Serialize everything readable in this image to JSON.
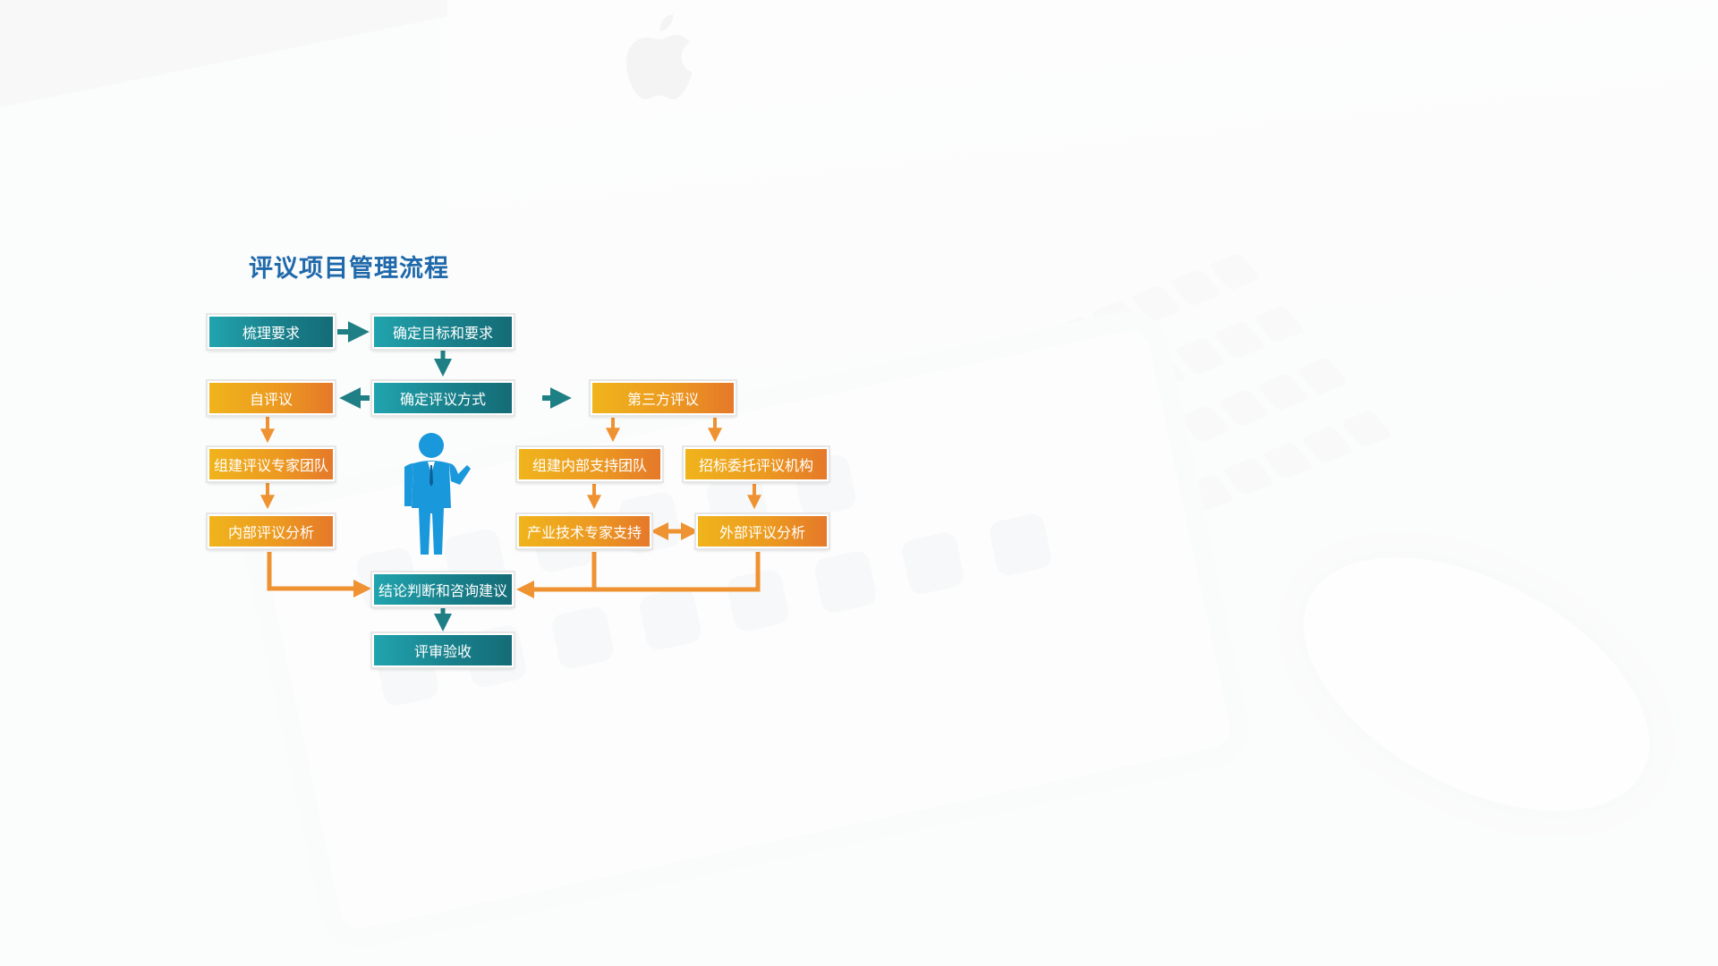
{
  "title": "评议项目管理流程",
  "colors": {
    "title": "#1f69ab",
    "teal": "#1a8792",
    "orange": "#ee9a20",
    "teal_arrow": "#1e7f85",
    "orange_arrow": "#ef9231",
    "person": "#1a98dc"
  },
  "nodes": {
    "sort_requirements": "梳理要求",
    "define_goals": "确定目标和要求",
    "define_method": "确定评议方式",
    "self_review": "自评议",
    "third_party": "第三方评议",
    "build_expert_team": "组建评议专家团队",
    "internal_analysis": "内部评议分析",
    "build_support_team": "组建内部支持团队",
    "tender_agency": "招标委托评议机构",
    "industry_expert_support": "产业技术专家支持",
    "external_analysis": "外部评议分析",
    "conclusion": "结论判断和咨询建议",
    "acceptance": "评审验收"
  },
  "icons": {
    "person": "business-person-icon",
    "apple": "apple-logo"
  }
}
